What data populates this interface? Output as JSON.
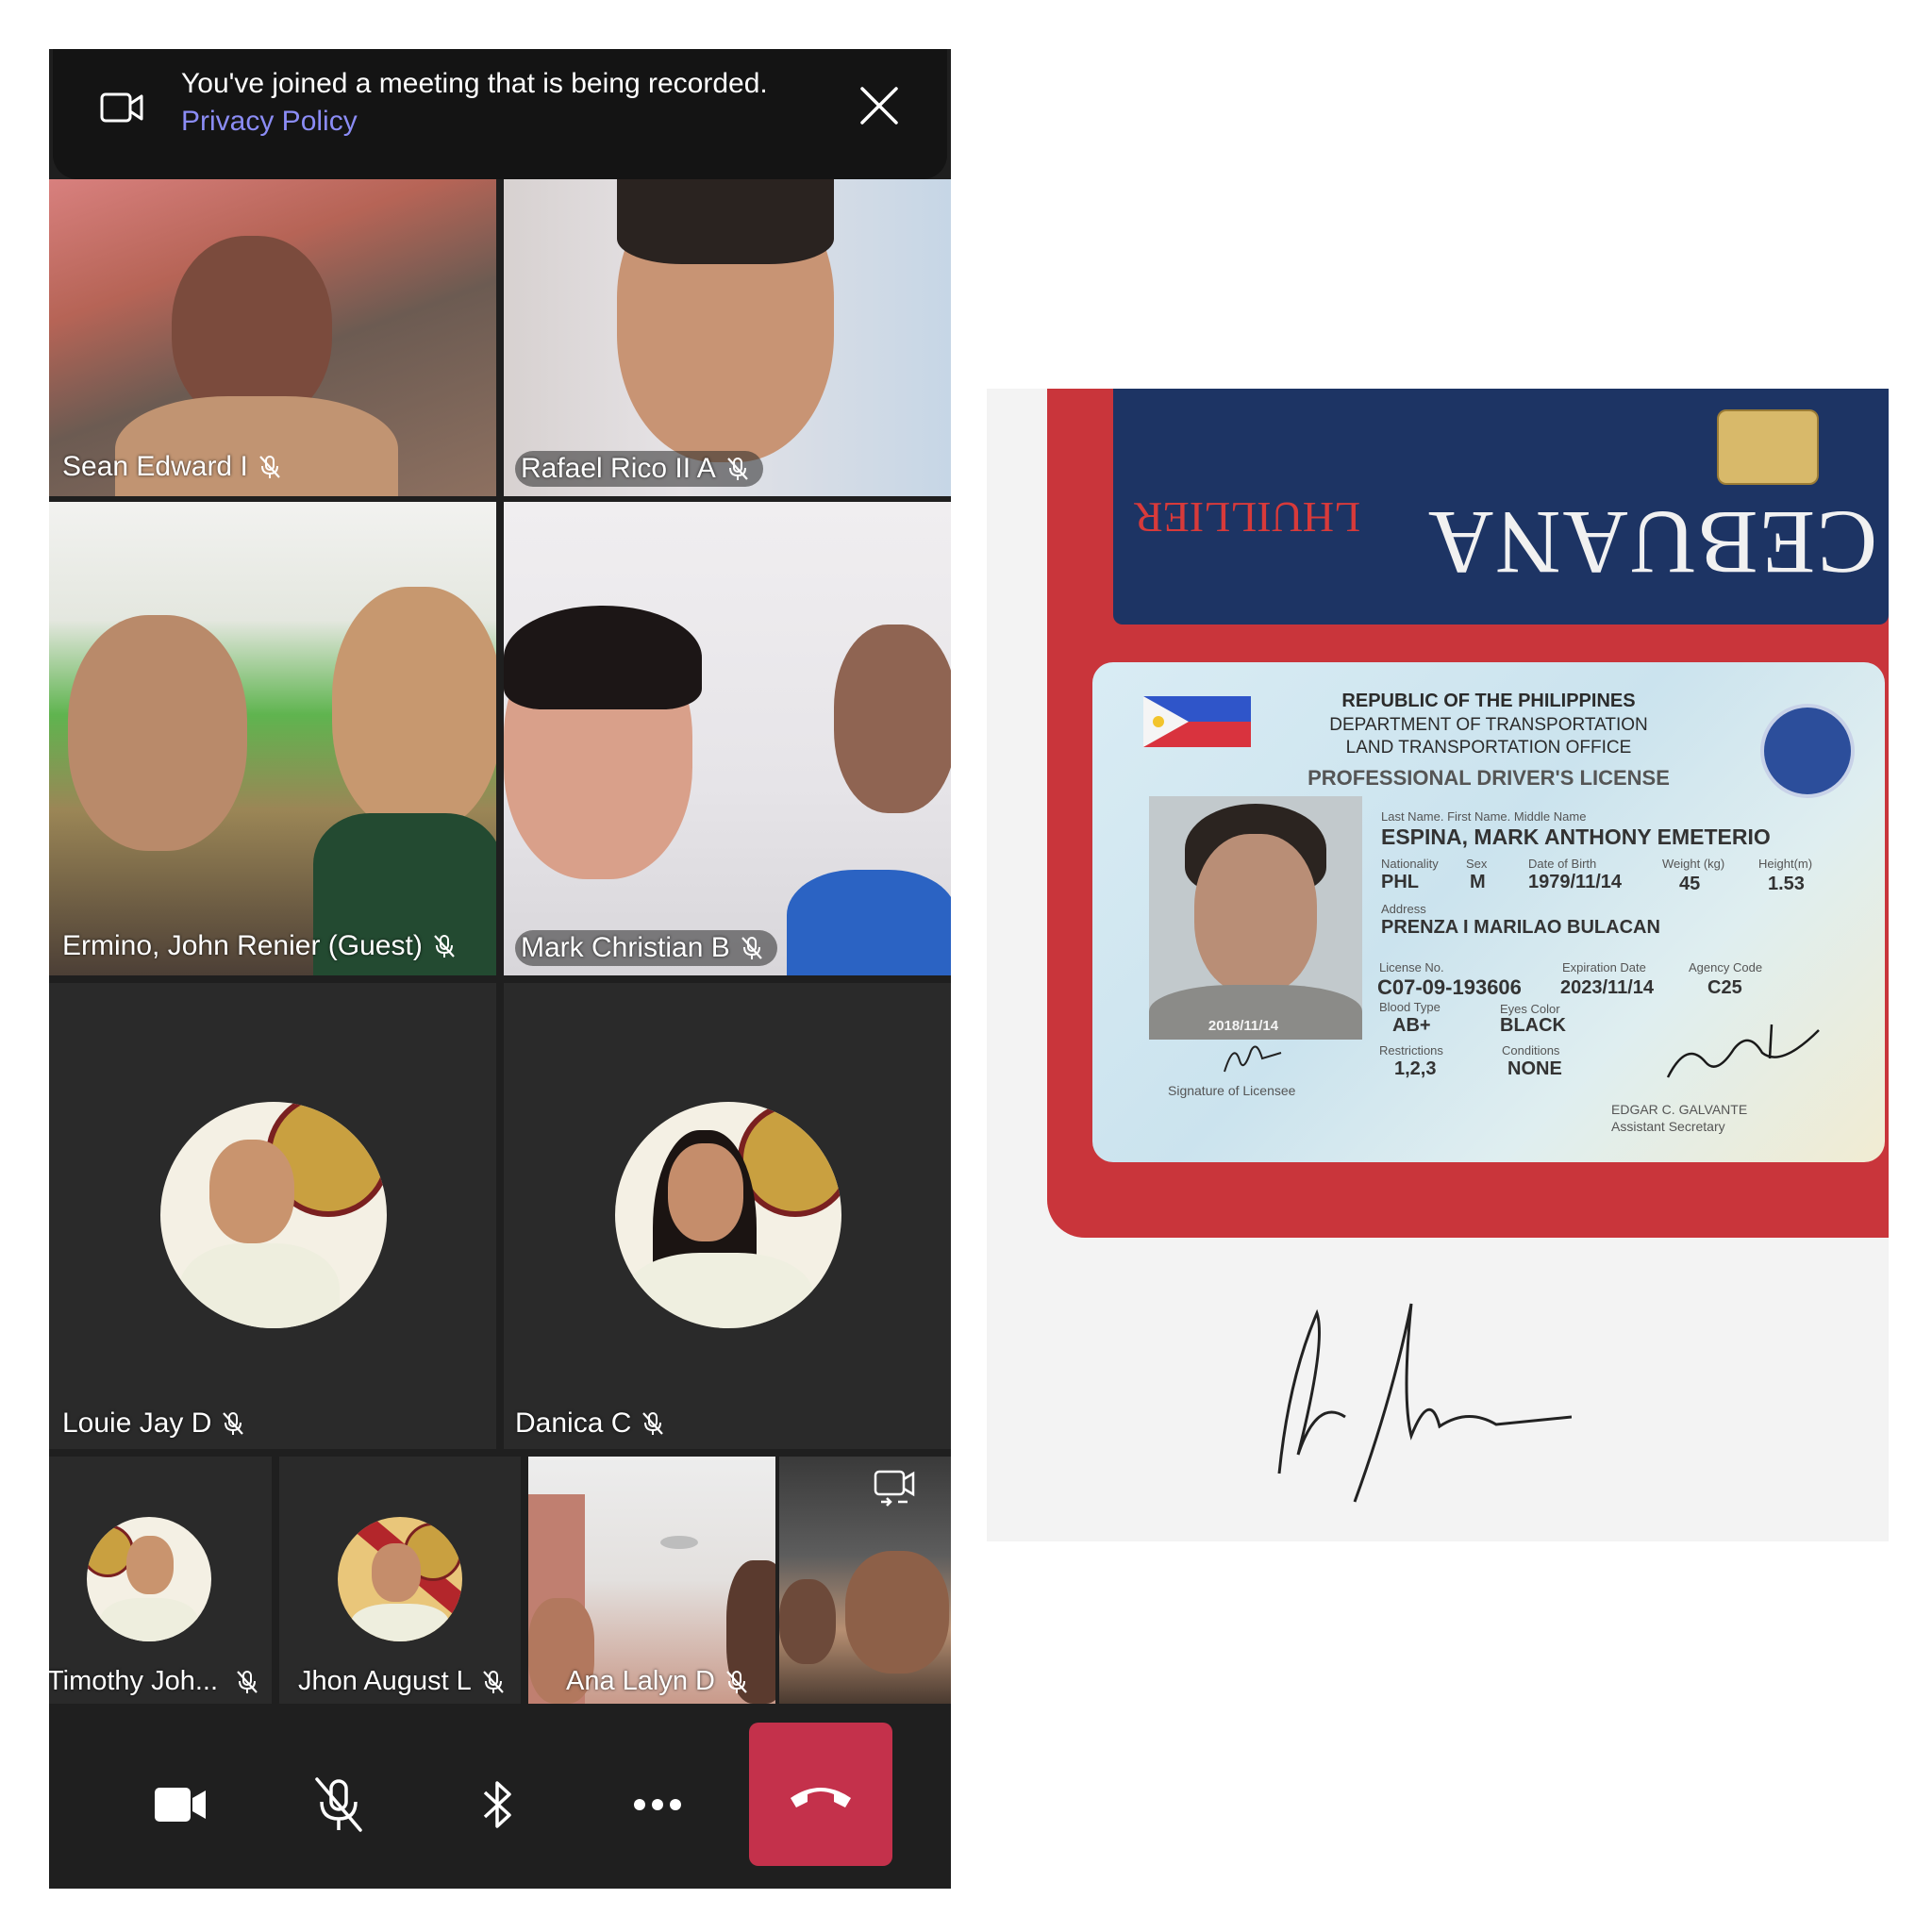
{
  "banner": {
    "message": "You've joined a meeting that is being recorded.",
    "link": "Privacy Policy"
  },
  "participants": [
    {
      "name": "Sean Edward I",
      "muted": true
    },
    {
      "name": "Rafael Rico II A",
      "muted": true
    },
    {
      "name": "Ermino, John Renier (Guest)",
      "muted": true
    },
    {
      "name": "Mark Christian B",
      "muted": true
    },
    {
      "name": "Louie Jay D",
      "muted": true
    },
    {
      "name": "Danica C",
      "muted": true
    },
    {
      "name": "Timothy Joh...",
      "muted": true
    },
    {
      "name": "Jhon August L",
      "muted": true
    },
    {
      "name": "Ana Lalyn D",
      "muted": true
    }
  ],
  "toolbar": {
    "camera": "video-camera-icon",
    "mic": "microphone-off-icon",
    "audio": "bluetooth-icon",
    "more": "more-icon",
    "hangup": "hang-up-icon"
  },
  "colors": {
    "background": "#1f1f1f",
    "link": "#8b8cf5",
    "hangup": "#c4314b"
  },
  "photo": {
    "wallet_card": {
      "brand": "CEBUANA",
      "sub": "LHUILLIER"
    },
    "license": {
      "line1": "REPUBLIC OF THE PHILIPPINES",
      "line2": "DEPARTMENT OF TRANSPORTATION",
      "line3": "LAND TRANSPORTATION OFFICE",
      "title": "PROFESSIONAL DRIVER'S LICENSE",
      "name_label": "Last Name. First Name. Middle Name",
      "name": "ESPINA, MARK ANTHONY EMETERIO",
      "nationality_label": "Nationality",
      "nationality": "PHL",
      "sex_label": "Sex",
      "sex": "M",
      "dob_label": "Date of Birth",
      "dob": "1979/11/14",
      "weight_label": "Weight (kg)",
      "weight": "45",
      "height_label": "Height(m)",
      "height": "1.53",
      "address_label": "Address",
      "address": "PRENZA I MARILAO BULACAN",
      "license_no_label": "License No.",
      "license_no": "C07-09-193606",
      "expiration_label": "Expiration Date",
      "expiration": "2023/11/14",
      "agency_label": "Agency Code",
      "agency": "C25",
      "blood_label": "Blood Type",
      "blood": "AB+",
      "eyes_label": "Eyes Color",
      "eyes": "BLACK",
      "restrictions_label": "Restrictions",
      "restrictions": "1,2,3",
      "conditions_label": "Conditions",
      "conditions": "NONE",
      "photo_date": "2018/11/14",
      "signature_label": "Signature of Licensee",
      "official_name": "EDGAR C. GALVANTE",
      "official_title": "Assistant Secretary"
    }
  }
}
